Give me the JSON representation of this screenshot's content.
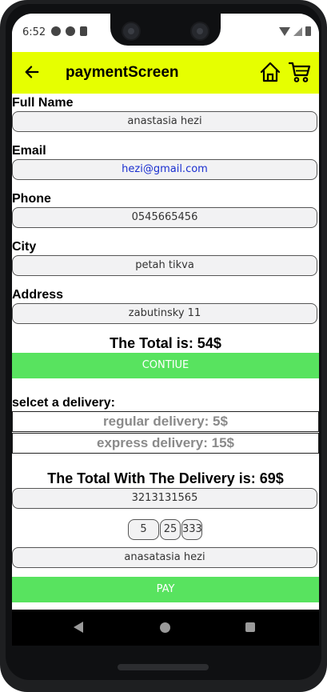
{
  "status_bar": {
    "time": "6:52"
  },
  "app_bar": {
    "title": "paymentScreen",
    "background": "#e6ff00"
  },
  "form": {
    "full_name": {
      "label": "Full Name",
      "value": "anastasia hezi"
    },
    "email": {
      "label": "Email",
      "value": "hezi@gmail.com"
    },
    "phone": {
      "label": "Phone",
      "value": "0545665456"
    },
    "city": {
      "label": "City",
      "value": "petah tikva"
    },
    "address": {
      "label": "Address",
      "value": "zabutinsky 11"
    }
  },
  "total_text": "The Total is: 54$",
  "continue_label": "CONTIUE",
  "delivery": {
    "heading": "selcet a delivery:",
    "options": [
      "regular delivery: 5$",
      "express delivery: 15$"
    ]
  },
  "total_with_delivery_text": "The Total With The Delivery is: 69$",
  "card": {
    "number": "3213131565",
    "month": "5",
    "year": "25",
    "cvv": "333",
    "holder": "anasatasia hezi"
  },
  "pay_label": "PAY",
  "colors": {
    "accent_green": "#58e35f",
    "link_blue": "#1a2fd0"
  },
  "icons": [
    "back-arrow-icon",
    "home-icon",
    "cart-icon",
    "gear-icon",
    "wifi-icon",
    "signal-icon",
    "battery-icon"
  ]
}
